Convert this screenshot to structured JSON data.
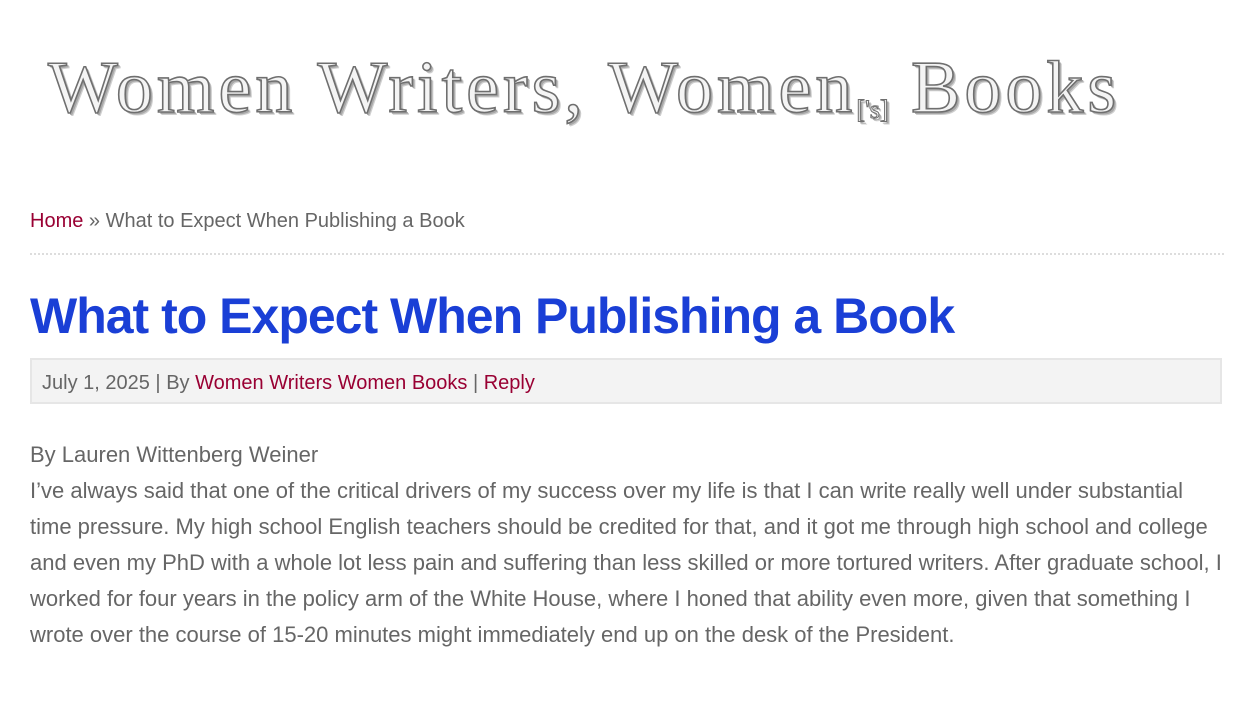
{
  "site": {
    "logo": {
      "part1": "Women Writers, Women",
      "part2": "['s]",
      "part3": "Books"
    }
  },
  "breadcrumb": {
    "home_label": "Home",
    "separator": "»",
    "current": "What to Expect When Publishing a Book"
  },
  "post": {
    "title": "What to Expect When Publishing a Book",
    "meta": {
      "date": "July 1, 2025",
      "sep1": "|",
      "by_label": "By",
      "author": "Women Writers Women Books",
      "sep2": "|",
      "reply_label": "Reply"
    },
    "byline": "By Lauren Wittenberg Weiner",
    "paragraph": "I’ve always said that one of the critical drivers of my success over my life is that I can write really well under substantial time pressure. My high school English teachers should be credited for that, and it got me through high school and college and even my PhD with a whole lot less pain and suffering than less skilled or more tortured writers. After graduate school, I worked for four years in the policy arm of the White House, where I honed that ability even more, given that something I wrote over the course of 15-20 minutes might immediately end up on the desk of the President."
  },
  "colors": {
    "link": "#990033",
    "title": "#1a3fd6",
    "text": "#666666",
    "meta_bg": "#f3f3f3"
  }
}
